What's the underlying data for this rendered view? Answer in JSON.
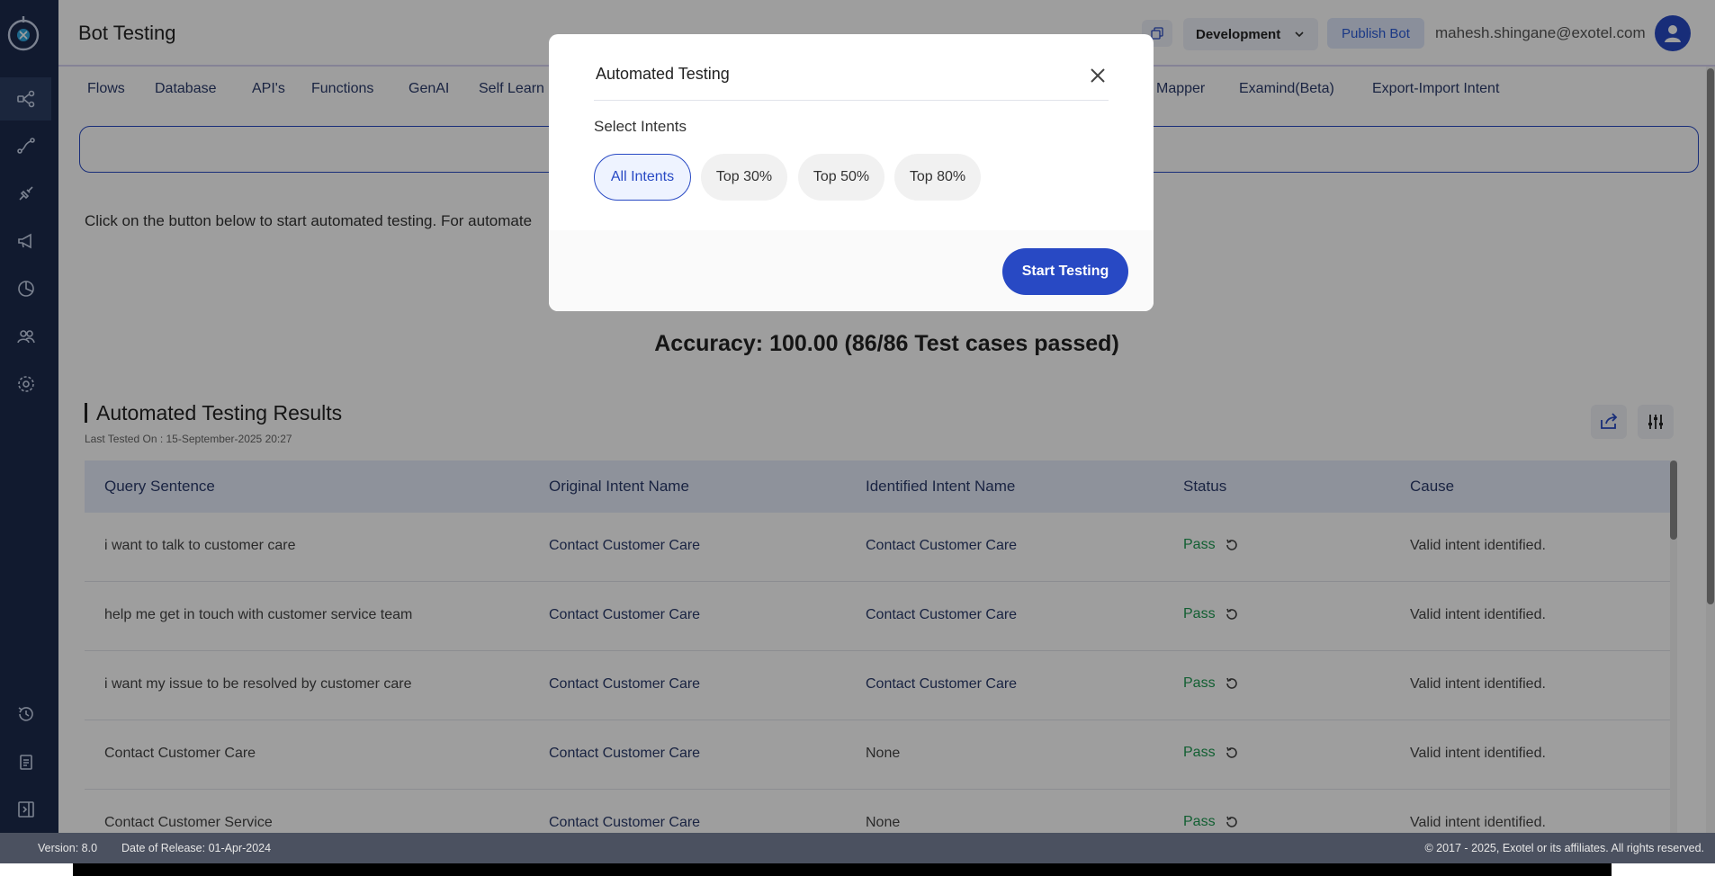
{
  "header": {
    "title": "Bot Testing",
    "environment": "Development",
    "publish_label": "Publish Bot",
    "user_email": "mahesh.shingane@exotel.com"
  },
  "tabs": [
    "Flows",
    "Database",
    "API's",
    "Functions",
    "GenAI",
    "Self Learn",
    "Mapper",
    "Examind(Beta)",
    "Export-Import Intent"
  ],
  "main": {
    "intro_text": "Click on the button below to start automated testing. For automate",
    "accuracy": "Accuracy: 100.00 (86/86 Test cases passed)",
    "results_title": "Automated Testing Results",
    "last_tested": "Last Tested On : 15-September-2025 20:27"
  },
  "table": {
    "headers": [
      "Query Sentence",
      "Original Intent Name",
      "Identified Intent Name",
      "Status",
      "Cause"
    ],
    "rows": [
      {
        "query": "i want to talk to customer care",
        "original": "Contact Customer Care",
        "identified": "Contact Customer Care",
        "status": "Pass",
        "cause": "Valid intent identified."
      },
      {
        "query": "help me get in touch with customer service team",
        "original": "Contact Customer Care",
        "identified": "Contact Customer Care",
        "status": "Pass",
        "cause": "Valid intent identified."
      },
      {
        "query": "i want my issue to be resolved by customer care",
        "original": "Contact Customer Care",
        "identified": "Contact Customer Care",
        "status": "Pass",
        "cause": "Valid intent identified."
      },
      {
        "query": "Contact Customer Care",
        "original": "Contact Customer Care",
        "identified": "None",
        "status": "Pass",
        "cause": "Valid intent identified."
      },
      {
        "query": "Contact Customer Service",
        "original": "Contact Customer Care",
        "identified": "None",
        "status": "Pass",
        "cause": "Valid intent identified."
      }
    ]
  },
  "footer": {
    "version": "Version: 8.0",
    "release": "Date of Release: 01-Apr-2024",
    "copyright": "© 2017 - 2025, Exotel or its affiliates. All rights reserved."
  },
  "modal": {
    "title": "Automated Testing",
    "select_label": "Select Intents",
    "chips": [
      "All Intents",
      "Top 30%",
      "Top 50%",
      "Top 80%"
    ],
    "selected_chip": "All Intents",
    "start_label": "Start Testing"
  },
  "colors": {
    "sidebar": "#1c2b4d",
    "accent": "#2849c4",
    "pass": "#1e9a52"
  },
  "icons": {
    "sidebar": [
      "flows-icon",
      "routes-icon",
      "integrations-icon",
      "campaign-icon",
      "analytics-icon",
      "users-icon",
      "settings-icon",
      "history-icon",
      "documents-icon",
      "collapse-icon"
    ]
  }
}
